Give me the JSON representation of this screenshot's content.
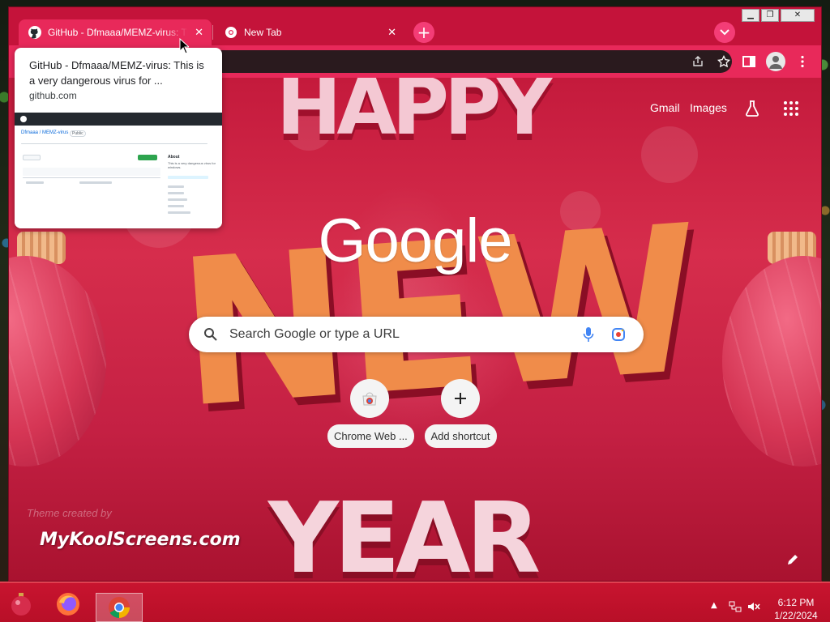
{
  "browser": {
    "tabs": [
      {
        "title": "GitHub - Dfmaaa/MEMZ-virus: Th",
        "favicon": "github-icon",
        "active": true
      },
      {
        "title": "New Tab",
        "favicon": "chrome-icon",
        "active": false
      }
    ],
    "window_controls": [
      "minimize",
      "restore",
      "close"
    ]
  },
  "hover_card": {
    "title": "GitHub - Dfmaaa/MEMZ-virus: This is a very dangerous virus for ...",
    "domain": "github.com",
    "preview": {
      "repo": "Dfmaaa / MEMZ-virus",
      "visibility": "Public",
      "about_heading": "About",
      "about_text": "This is a very dangerous virus for windows."
    }
  },
  "ntp": {
    "links": {
      "gmail": "Gmail",
      "images": "Images"
    },
    "logo": "Google",
    "search": {
      "placeholder": "Search Google or type a URL"
    },
    "shortcuts": [
      {
        "label": "Chrome Web ...",
        "icon": "chrome-webstore-icon"
      },
      {
        "label": "Add shortcut",
        "icon": "plus-icon"
      }
    ],
    "theme_credit": "Theme created by",
    "theme_site": "MyKoolScreens.com",
    "background_text": {
      "top": "HAPPY",
      "middle": "NEW",
      "bottom": "YEAR"
    }
  },
  "taskbar": {
    "apps": [
      "start-ornament-icon",
      "firefox-icon",
      "chrome-icon"
    ],
    "time": "6:12 PM",
    "date": "1/22/2024"
  },
  "colors": {
    "frame": "#c4133a",
    "active_tab": "#e8295a",
    "accent_button": "#f43d76",
    "omnibox": "#2a1a1e",
    "taskbar": "#c8142f"
  }
}
